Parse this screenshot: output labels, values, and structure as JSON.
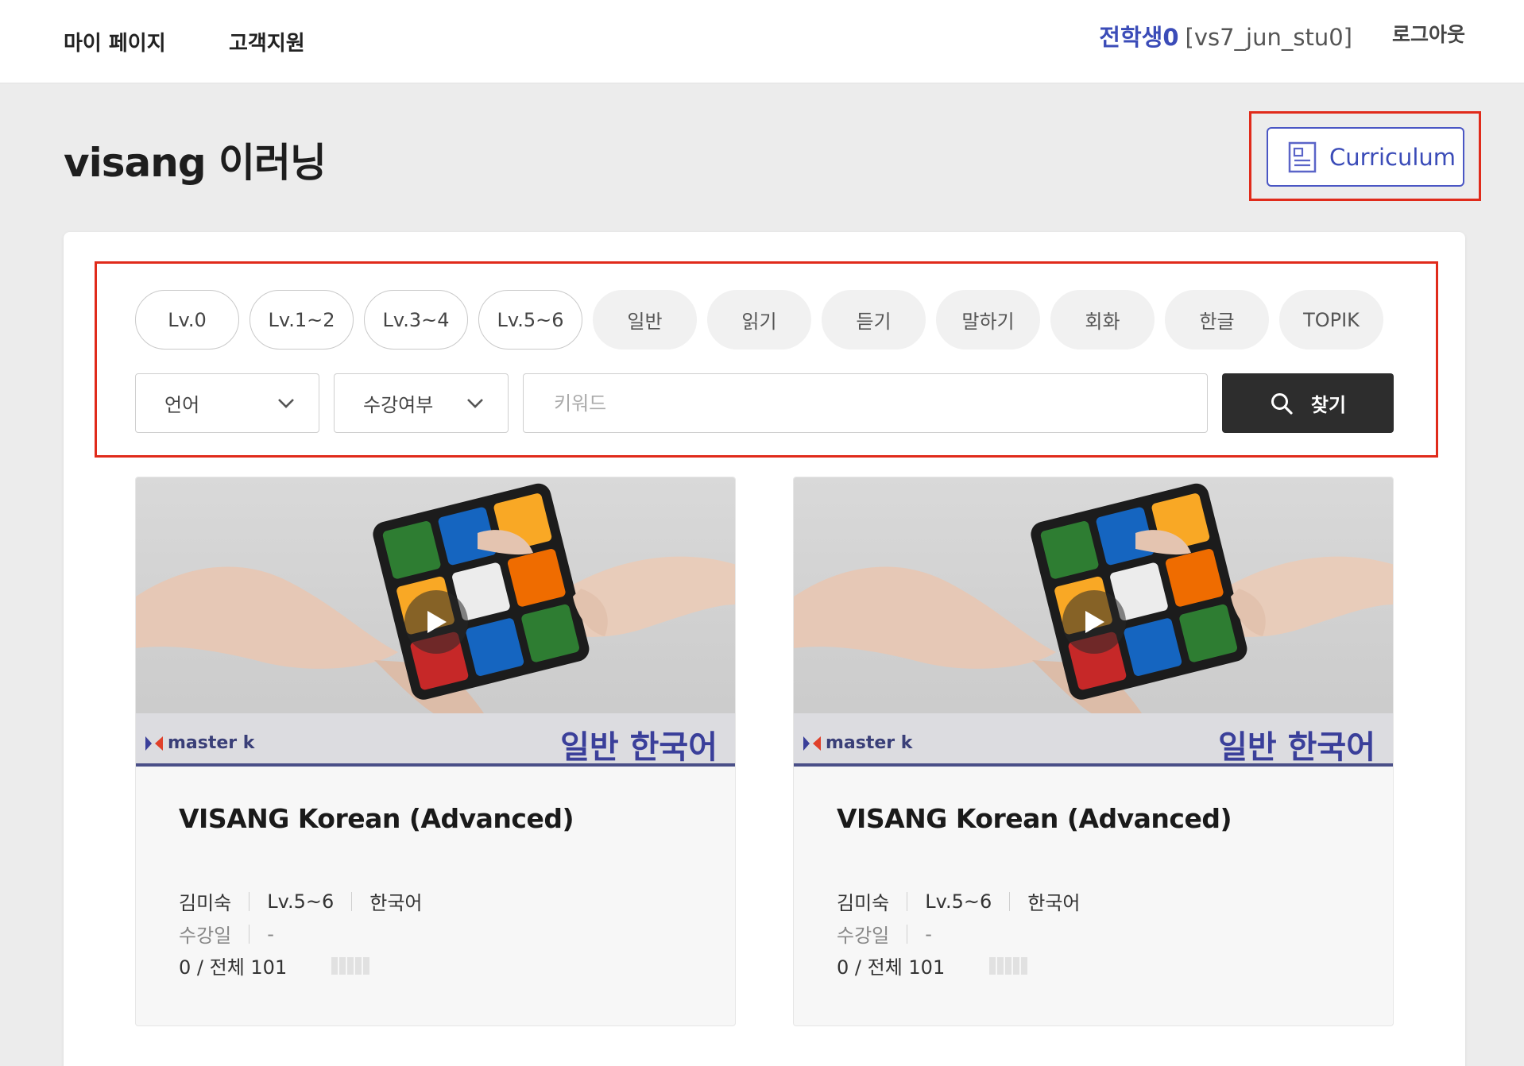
{
  "header": {
    "nav": [
      "마이 페이지",
      "고객지원"
    ],
    "user_name": "전학생0",
    "user_id": "[vs7_jun_stu0]",
    "logout_label": "로그아웃"
  },
  "page": {
    "title": "visang 이러닝",
    "curriculum_label": "Curriculum"
  },
  "filters": {
    "chips": [
      {
        "label": "Lv.0",
        "style": "outline"
      },
      {
        "label": "Lv.1~2",
        "style": "outline"
      },
      {
        "label": "Lv.3~4",
        "style": "outline"
      },
      {
        "label": "Lv.5~6",
        "style": "outline"
      },
      {
        "label": "일반",
        "style": "filled"
      },
      {
        "label": "읽기",
        "style": "filled"
      },
      {
        "label": "듣기",
        "style": "filled"
      },
      {
        "label": "말하기",
        "style": "filled"
      },
      {
        "label": "회화",
        "style": "filled"
      },
      {
        "label": "한글",
        "style": "filled"
      },
      {
        "label": "TOPIK",
        "style": "filled"
      }
    ],
    "language_select": "언어",
    "status_select": "수강여부",
    "keyword_placeholder": "키워드",
    "search_label": "찾기"
  },
  "courses": [
    {
      "brand": "master k",
      "subject": "일반 한국어",
      "title": "VISANG Korean (Advanced)",
      "teacher": "김미숙",
      "level": "Lv.5~6",
      "language": "한국어",
      "period_label": "수강일",
      "period_value": "-",
      "progress_text": "0 / 전체 101",
      "progress_fraction": 0
    },
    {
      "brand": "master k",
      "subject": "일반 한국어",
      "title": "VISANG Korean (Advanced)",
      "teacher": "김미숙",
      "level": "Lv.5~6",
      "language": "한국어",
      "period_label": "수강일",
      "period_value": "-",
      "progress_text": "0 / 전체 101",
      "progress_fraction": 0
    }
  ],
  "colors": {
    "accent": "#3b4cb8",
    "highlight_box": "#e02b1b",
    "search_button": "#2d2d2d"
  }
}
